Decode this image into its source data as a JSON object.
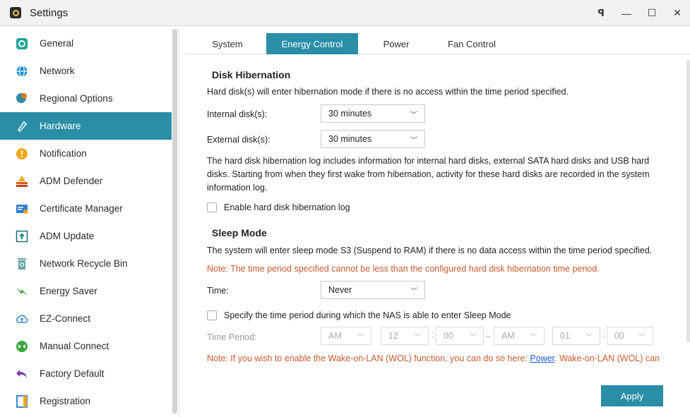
{
  "window": {
    "title": "Settings",
    "controls": {
      "pin": "ꟼ",
      "minimize": "—",
      "maximize": "☐",
      "close": "✕"
    }
  },
  "sidebar": {
    "items": [
      {
        "label": "General",
        "icon": "general-icon",
        "color": "#1aa39a"
      },
      {
        "label": "Network",
        "icon": "globe-icon",
        "color": "#1f8fd6"
      },
      {
        "label": "Regional Options",
        "icon": "regional-icon",
        "color": "#2a8ea7"
      },
      {
        "label": "Hardware",
        "icon": "hardware-icon",
        "color": "#ffffff",
        "active": true
      },
      {
        "label": "Notification",
        "icon": "notification-icon",
        "color": "#f0a71a"
      },
      {
        "label": "ADM Defender",
        "icon": "defender-icon",
        "color": "#e07a1a"
      },
      {
        "label": "Certificate Manager",
        "icon": "certificate-icon",
        "color": "#2f7dd4"
      },
      {
        "label": "ADM Update",
        "icon": "update-icon",
        "color": "#1a8a7a"
      },
      {
        "label": "Network Recycle Bin",
        "icon": "recycle-bin-icon",
        "color": "#6aa3a3"
      },
      {
        "label": "Energy Saver",
        "icon": "energy-saver-icon",
        "color": "#3aa53a"
      },
      {
        "label": "EZ-Connect",
        "icon": "cloud-icon",
        "color": "#3a88c8"
      },
      {
        "label": "Manual Connect",
        "icon": "manual-connect-icon",
        "color": "#3aa53a"
      },
      {
        "label": "Factory Default",
        "icon": "undo-icon",
        "color": "#7a3fb0"
      },
      {
        "label": "Registration",
        "icon": "registration-icon",
        "color": "#2a7ac8"
      }
    ]
  },
  "tabs": [
    {
      "label": "System"
    },
    {
      "label": "Energy Control",
      "active": true
    },
    {
      "label": "Power"
    },
    {
      "label": "Fan Control"
    }
  ],
  "disk_hibernation": {
    "title": "Disk Hibernation",
    "description": "Hard disk(s) will enter hibernation mode if there is no access within the time period specified.",
    "internal_label": "Internal disk(s):",
    "internal_value": "30 minutes",
    "external_label": "External disk(s):",
    "external_value": "30 minutes",
    "log_info_1": "The hard disk hibernation log includes information for internal hard disks, external SATA hard disks and USB hard",
    "log_info_2": "disks. Starting from when they first wake from hibernation, activity for these hard disks are recorded in the system",
    "log_info_3": "information log.",
    "enable_log_label": "Enable hard disk hibernation log",
    "enable_log_checked": false
  },
  "sleep_mode": {
    "title": "Sleep Mode",
    "description": "The system will enter sleep mode S3 (Suspend to RAM) if there is no data access within the time period specified.",
    "note": "Note: The time period specified cannot be less than the configured hard disk hibernation time period.",
    "time_label": "Time:",
    "time_value": "Never",
    "specify_label": "Specify the time period during which the NAS is able to enter Sleep Mode",
    "specify_checked": false,
    "period_label": "Time Period:",
    "start_ampm": "AM",
    "start_hour": "12",
    "start_minute": "00",
    "end_ampm": "AM",
    "end_hour": "01",
    "end_minute": "00",
    "colon": ":",
    "tilde": "~",
    "wol_note_before": "Note: If you wish to enable the Wake-on-LAN (WOL) function, you can do so here: ",
    "wol_link": "Power",
    "wol_note_after": ". Wake-on-LAN (WOL) can"
  },
  "apply_label": "Apply",
  "chevron": "⌵"
}
